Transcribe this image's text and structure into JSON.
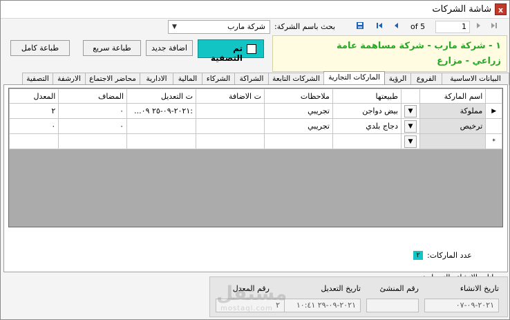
{
  "window": {
    "title": "شاشة الشركات",
    "close_label": "x"
  },
  "navigator": {
    "first_icon": "first-record-icon",
    "prev_icon": "previous-record-icon",
    "current_record": "1",
    "of_text": "of 5",
    "next_icon": "next-record-icon",
    "last_icon": "last-record-icon",
    "save_icon": "save-icon"
  },
  "search": {
    "label": "بحث باسم الشركة:",
    "selected": "شركة مارب"
  },
  "buttons": {
    "full_print": "طباعة كامل",
    "quick_print": "طباعة سريع",
    "add_new": "اضافة جديد"
  },
  "filter": {
    "label": "تم التصفية",
    "checked": false
  },
  "company_info": {
    "line1": "١ - شركة مارب - شركة مساهمة عامة",
    "line2": "زراعي - مزارع"
  },
  "tabs": [
    {
      "label": "البيانات الاساسية",
      "active": false
    },
    {
      "label": "الفروع",
      "active": false
    },
    {
      "label": "الرؤية",
      "active": false
    },
    {
      "label": "الماركات التجارية",
      "active": true
    },
    {
      "label": "الشركات التابعة",
      "active": false
    },
    {
      "label": "الشراكة",
      "active": false
    },
    {
      "label": "الشركاء",
      "active": false
    },
    {
      "label": "المالية",
      "active": false
    },
    {
      "label": "الادارية",
      "active": false
    },
    {
      "label": "محاضر الاجتماع",
      "active": false
    },
    {
      "label": "الارشفة",
      "active": false
    },
    {
      "label": "التصفية",
      "active": false
    }
  ],
  "grid": {
    "columns": [
      "اسم الماركة",
      "طبيعتها",
      "ملاحظات",
      "ت الاضافة",
      "ت التعديل",
      "المضاف",
      "المعدل"
    ],
    "rows": [
      {
        "marker": "▶",
        "name": "مملوكة",
        "nature": "بيض دواجن",
        "notes": "تجريبي",
        "added": "",
        "modified": "...٢٠٢١-٠٩-٢٥ ٠٩:",
        "adder": "٠",
        "modifier": "٢"
      },
      {
        "marker": "",
        "name": "ترخيص",
        "nature": "دجاج بلدي",
        "notes": "تجريبي",
        "added": "",
        "modified": "",
        "adder": "٠",
        "modifier": "٠"
      },
      {
        "marker": "*",
        "name": "",
        "nature": "",
        "notes": "",
        "added": "",
        "modified": "",
        "adder": "",
        "modifier": ""
      }
    ]
  },
  "marks_count": {
    "label": "عدد الماركات:",
    "value": "٢"
  },
  "audit": {
    "title": "بيانات الانشاء والتعديل :",
    "created_date_label": "تاريخ الانشاء",
    "creator_label": "رقم المنشئ",
    "modified_date_label": "تاريخ التعديل",
    "modifier_label": "رقم المعدل",
    "created_date": "٢٠٢١-٠٩-٠٧",
    "creator": "",
    "modified_date": "٢٠٢١-٠٩-٢٩ ١٠:٤١",
    "modifier": "٢"
  },
  "watermark": {
    "main": "مستقل",
    "sub": "mostaql.com"
  },
  "colors": {
    "accent": "#13c4c4",
    "info_text": "#28a728",
    "info_bg": "#fffce1",
    "close": "#c0392b"
  }
}
